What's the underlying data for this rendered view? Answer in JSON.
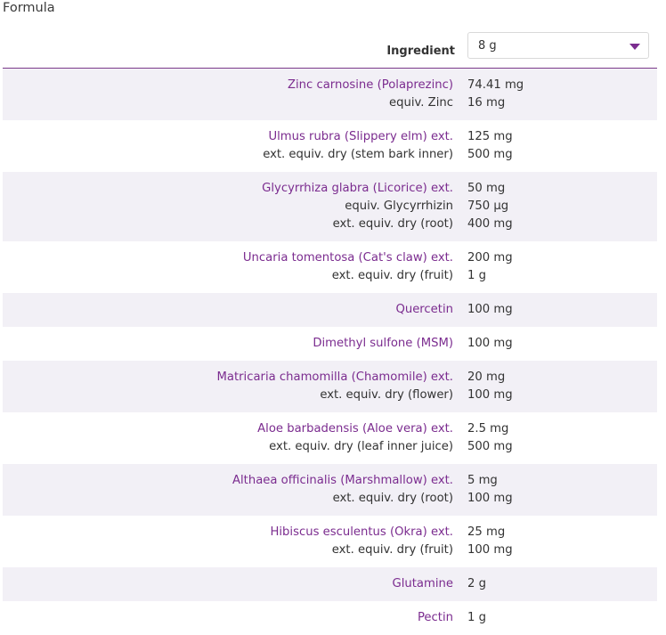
{
  "section_title": "Formula",
  "header": {
    "label": "Ingredient",
    "select_value": "8 g"
  },
  "rows": [
    {
      "lines": [
        {
          "name": "Zinc carnosine (Polaprezinc)",
          "amount": "74.41 mg",
          "primary": true
        },
        {
          "name": "equiv. Zinc",
          "amount": "16 mg",
          "primary": false
        }
      ]
    },
    {
      "lines": [
        {
          "name": "Ulmus rubra (Slippery elm) ext.",
          "amount": "125 mg",
          "primary": true
        },
        {
          "name": "ext. equiv. dry (stem bark inner)",
          "amount": "500 mg",
          "primary": false
        }
      ]
    },
    {
      "lines": [
        {
          "name": "Glycyrrhiza glabra (Licorice) ext.",
          "amount": "50 mg",
          "primary": true
        },
        {
          "name": "equiv. Glycyrrhizin",
          "amount": "750 µg",
          "primary": false
        },
        {
          "name": "ext. equiv. dry (root)",
          "amount": "400 mg",
          "primary": false
        }
      ]
    },
    {
      "lines": [
        {
          "name": "Uncaria tomentosa (Cat's claw) ext.",
          "amount": "200 mg",
          "primary": true
        },
        {
          "name": "ext. equiv. dry (fruit)",
          "amount": "1 g",
          "primary": false
        }
      ]
    },
    {
      "lines": [
        {
          "name": "Quercetin",
          "amount": "100 mg",
          "primary": true
        }
      ]
    },
    {
      "lines": [
        {
          "name": "Dimethyl sulfone (MSM)",
          "amount": "100 mg",
          "primary": true
        }
      ]
    },
    {
      "lines": [
        {
          "name": "Matricaria chamomilla (Chamomile) ext.",
          "amount": "20 mg",
          "primary": true
        },
        {
          "name": "ext. equiv. dry (flower)",
          "amount": "100 mg",
          "primary": false
        }
      ]
    },
    {
      "lines": [
        {
          "name": "Aloe barbadensis (Aloe vera) ext.",
          "amount": "2.5 mg",
          "primary": true
        },
        {
          "name": "ext. equiv. dry (leaf inner juice)",
          "amount": "500 mg",
          "primary": false
        }
      ]
    },
    {
      "lines": [
        {
          "name": "Althaea officinalis (Marshmallow) ext.",
          "amount": "5 mg",
          "primary": true
        },
        {
          "name": "ext. equiv. dry (root)",
          "amount": "100 mg",
          "primary": false
        }
      ]
    },
    {
      "lines": [
        {
          "name": "Hibiscus esculentus (Okra) ext.",
          "amount": "25 mg",
          "primary": true
        },
        {
          "name": "ext. equiv. dry (fruit)",
          "amount": "100 mg",
          "primary": false
        }
      ]
    },
    {
      "lines": [
        {
          "name": "Glutamine",
          "amount": "2 g",
          "primary": true
        }
      ]
    },
    {
      "lines": [
        {
          "name": "Pectin",
          "amount": "1 g",
          "primary": true
        }
      ]
    }
  ],
  "colors": {
    "accent": "#7b2c8f",
    "row_shade": "#f2f0f6",
    "text": "#333333"
  }
}
